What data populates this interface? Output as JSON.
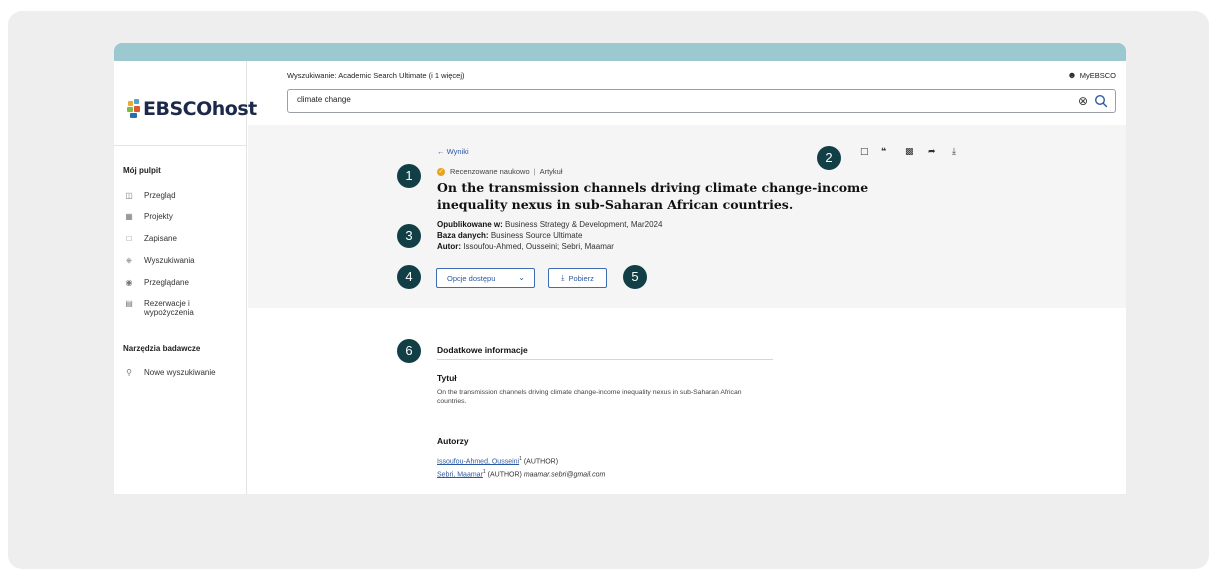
{
  "header": {
    "search_label": "Wyszukiwanie:  Academic Search Ultimate (i 1 więcej)",
    "account_label": "MyEBSCO",
    "search_value": "climate change"
  },
  "logo": {
    "text": "EBSCOhost"
  },
  "sidebar": {
    "section1_title": "Mój pulpit",
    "items": [
      {
        "label": "Przegląd",
        "icon": "columns-icon"
      },
      {
        "label": "Projekty",
        "icon": "folders-icon"
      },
      {
        "label": "Zapisane",
        "icon": "bookmark-icon"
      },
      {
        "label": "Wyszukiwania",
        "icon": "search-doc-icon"
      },
      {
        "label": "Przeglądane",
        "icon": "eye-icon"
      },
      {
        "label": "Rezerwacje i wypożyczenia",
        "icon": "books-icon"
      }
    ],
    "section2_title": "Narzędzia badawcze",
    "tools": [
      {
        "label": "Nowe wyszukiwanie",
        "icon": "search-icon"
      }
    ]
  },
  "record": {
    "back_label": "Wyniki",
    "badge_peer": "Recenzowane naukowo",
    "badge_type": "Artykuł",
    "title": "On the transmission channels driving climate change-income inequality nexus in sub-Saharan African countries.",
    "published_label": "Opublikowane w:",
    "published_value": "Business Strategy & Development, Mar2024",
    "database_label": "Baza danych:",
    "database_value": "Business Source Ultimate",
    "author_label": "Autor:",
    "author_value": "Issoufou-Ahmed, Ousseini; Sebri, Maamar",
    "access_button": "Opcje dostępu",
    "download_button": "Pobierz"
  },
  "toolbar": [
    "bookmark-icon",
    "quote-icon",
    "folder-add-icon",
    "share-icon",
    "download-icon"
  ],
  "markers": [
    "1",
    "2",
    "3",
    "4",
    "5",
    "6"
  ],
  "details": {
    "section_title": "Dodatkowe informacje",
    "title_heading": "Tytuł",
    "title_text": "On the transmission channels driving climate change-income inequality nexus in sub-Saharan African countries.",
    "authors_heading": "Autorzy",
    "authors": [
      {
        "name": "Issoufou-Ahmed, Ousseini",
        "sup": "1",
        "role": "(AUTHOR)",
        "email": ""
      },
      {
        "name": "Sebri, Maamar",
        "sup": "1",
        "role": "(AUTHOR)",
        "email": "maamar.sebri@gmail.com"
      }
    ]
  },
  "colors": {
    "topbar": "#9cc8cf",
    "marker": "#123f46",
    "link": "#2c5aa0",
    "peer_badge": "#e7a21f"
  }
}
